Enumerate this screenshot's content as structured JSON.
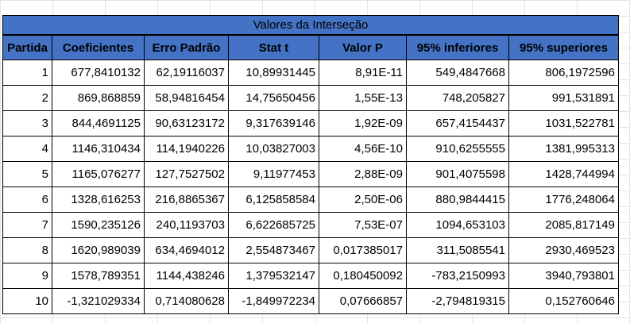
{
  "table": {
    "title": "Valores da Interseção",
    "headers": [
      "Partida",
      "Coeficientes",
      "Erro Padrão",
      "Stat t",
      "Valor P",
      "95% inferiores",
      "95% superiores"
    ],
    "rows": [
      [
        "1",
        "677,8410132",
        "62,19116037",
        "10,89931445",
        "8,91E-11",
        "549,4847668",
        "806,1972596"
      ],
      [
        "2",
        "869,868859",
        "58,94816454",
        "14,75650456",
        "1,55E-13",
        "748,205827",
        "991,531891"
      ],
      [
        "3",
        "844,4691125",
        "90,63123172",
        "9,317639146",
        "1,92E-09",
        "657,4154437",
        "1031,522781"
      ],
      [
        "4",
        "1146,310434",
        "114,1940226",
        "10,03827003",
        "4,56E-10",
        "910,6255555",
        "1381,995313"
      ],
      [
        "5",
        "1165,076277",
        "127,7527502",
        "9,11977453",
        "2,88E-09",
        "901,4075598",
        "1428,744994"
      ],
      [
        "6",
        "1328,616253",
        "216,8865367",
        "6,125858584",
        "2,50E-06",
        "880,9844415",
        "1776,248064"
      ],
      [
        "7",
        "1590,235126",
        "240,1193703",
        "6,622685725",
        "7,53E-07",
        "1094,653103",
        "2085,817149"
      ],
      [
        "8",
        "1620,989039",
        "634,4694012",
        "2,554873467",
        "0,017385017",
        "311,5085541",
        "2930,469523"
      ],
      [
        "9",
        "1578,789351",
        "1144,438246",
        "1,379532147",
        "0,180450092",
        "-783,2150993",
        "3940,793801"
      ],
      [
        "10",
        "-1,321029334",
        "0,714080628",
        "-1,849972234",
        "0,07666857",
        "-2,794819315",
        "0,152760646"
      ]
    ]
  },
  "colors": {
    "header_fill": "#4472c4"
  }
}
